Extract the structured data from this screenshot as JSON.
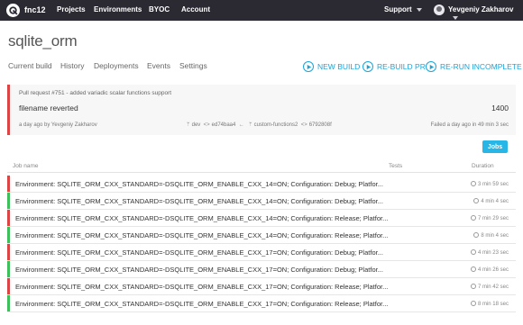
{
  "topbar": {
    "org": "fnc12",
    "nav": [
      "Projects",
      "Environments",
      "BYOC",
      "Account"
    ],
    "support": "Support",
    "user": "Yevgeniy Zakharov",
    "background": "#2b2a33"
  },
  "repo": {
    "title": "sqlite_orm"
  },
  "tabs": [
    "Current build",
    "History",
    "Deployments",
    "Events",
    "Settings"
  ],
  "actions": {
    "new_build": "NEW BUILD",
    "rebuild_pr": "RE-BUILD PR",
    "rerun_incomplete": "RE-RUN INCOMPLETE"
  },
  "accent_color": "#1aa5d8",
  "build": {
    "pr_title": "Pull request #751 - added variadic scalar functions support",
    "commit_message": "filename reverted",
    "number": "1400",
    "author_line": "a day ago by Yevgeniy Zakharov",
    "base_branch": "dev",
    "base_commit": "ed74baa4",
    "head_branch": "custom-functions2",
    "head_commit": "6792808f",
    "status_line": "Failed a day ago in 49 min 3 sec",
    "status_color": "#db4545"
  },
  "jobs_button": "Jobs",
  "table": {
    "headers": {
      "job_name": "Job name",
      "tests": "Tests",
      "duration": "Duration"
    },
    "rows": [
      {
        "name": "Environment: SQLITE_ORM_CXX_STANDARD=-DSQLITE_ORM_ENABLE_CXX_14=ON; Configuration: Debug; Platfor...",
        "duration": "3 min 59 sec",
        "status": "failed"
      },
      {
        "name": "Environment: SQLITE_ORM_CXX_STANDARD=-DSQLITE_ORM_ENABLE_CXX_14=ON; Configuration: Debug; Platfor...",
        "duration": "4 min 4 sec",
        "status": "passed"
      },
      {
        "name": "Environment: SQLITE_ORM_CXX_STANDARD=-DSQLITE_ORM_ENABLE_CXX_14=ON; Configuration: Release; Platfor...",
        "duration": "7 min 29 sec",
        "status": "failed"
      },
      {
        "name": "Environment: SQLITE_ORM_CXX_STANDARD=-DSQLITE_ORM_ENABLE_CXX_14=ON; Configuration: Release; Platfor...",
        "duration": "8 min 4 sec",
        "status": "passed"
      },
      {
        "name": "Environment: SQLITE_ORM_CXX_STANDARD=-DSQLITE_ORM_ENABLE_CXX_17=ON; Configuration: Debug; Platfor...",
        "duration": "4 min 23 sec",
        "status": "failed"
      },
      {
        "name": "Environment: SQLITE_ORM_CXX_STANDARD=-DSQLITE_ORM_ENABLE_CXX_17=ON; Configuration: Debug; Platfor...",
        "duration": "4 min 26 sec",
        "status": "passed"
      },
      {
        "name": "Environment: SQLITE_ORM_CXX_STANDARD=-DSQLITE_ORM_ENABLE_CXX_17=ON; Configuration: Release; Platfor...",
        "duration": "7 min 42 sec",
        "status": "failed"
      },
      {
        "name": "Environment: SQLITE_ORM_CXX_STANDARD=-DSQLITE_ORM_ENABLE_CXX_17=ON; Configuration: Release; Platfor...",
        "duration": "8 min 18 sec",
        "status": "passed"
      }
    ]
  },
  "status_colors": {
    "failed": "#db4545",
    "passed": "#3fbf5c"
  }
}
